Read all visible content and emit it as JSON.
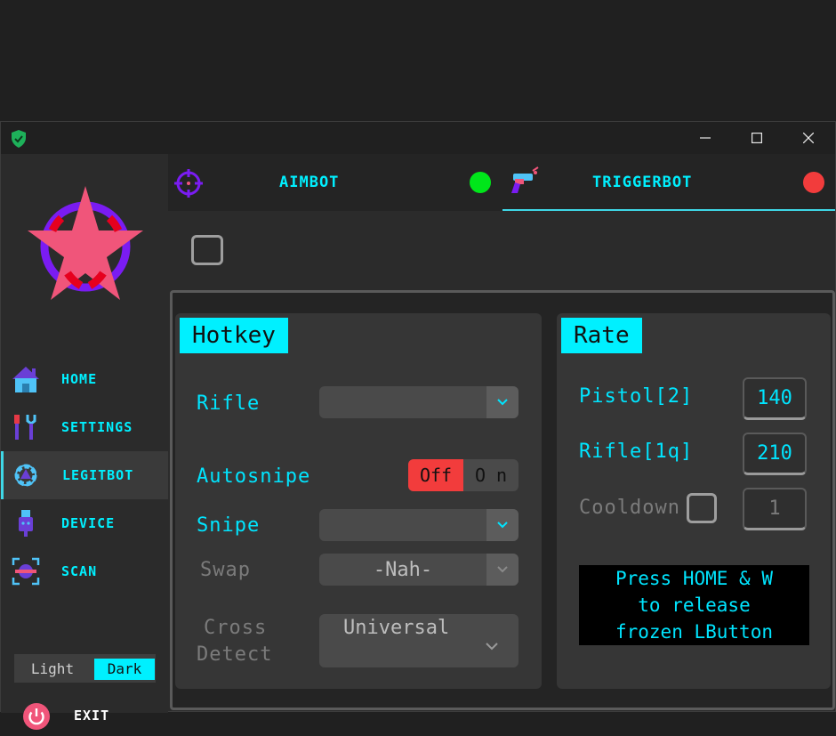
{
  "titlebar": {
    "app_icon": "shield-check-icon",
    "minimize": "—",
    "maximize": "☐",
    "close": "✕"
  },
  "sidebar": {
    "logo": "star-crosshair-logo",
    "items": [
      {
        "label": "HOME",
        "icon": "home-icon"
      },
      {
        "label": "SETTINGS",
        "icon": "tools-icon"
      },
      {
        "label": "LEGITBOT",
        "icon": "gear-icon",
        "active": true
      },
      {
        "label": "DEVICE",
        "icon": "usb-icon"
      },
      {
        "label": "SCAN",
        "icon": "scan-icon"
      }
    ],
    "theme": {
      "light": "Light",
      "dark": "Dark",
      "selected": "Dark"
    },
    "exit_label": "EXIT"
  },
  "tabs": {
    "aimbot": {
      "label": "AIMBOT",
      "status_color": "#00e61a"
    },
    "triggerbot": {
      "label": "TRIGGERBOT",
      "status_color": "#f23c3c",
      "active": true
    }
  },
  "hotkey_panel": {
    "title": "Hotkey",
    "rifle_label": "Rifle",
    "rifle_value": "",
    "autosnipe_label": "Autosnipe",
    "toggle_off": "Off",
    "toggle_on": "O n",
    "toggle_state": "Off",
    "snipe_label": "Snipe",
    "snipe_value": "",
    "swap_label": "Swap",
    "swap_value": "-Nah-",
    "cross_label_1": "Cross",
    "cross_label_2": "Detect",
    "cross_value": "Universal"
  },
  "rate_panel": {
    "title": "Rate",
    "pistol_label": "Pistol[2]",
    "pistol_value": "140",
    "rifle_label": "Rifle[1q]",
    "rifle_value": "210",
    "cooldown_label": "Cooldown",
    "cooldown_value": "1",
    "note_line1": "Press HOME & W",
    "note_line2": "to release",
    "note_line3": "frozen LButton"
  },
  "colors": {
    "accent": "#00f0ff",
    "danger": "#f23c3c",
    "ok": "#00e61a"
  }
}
